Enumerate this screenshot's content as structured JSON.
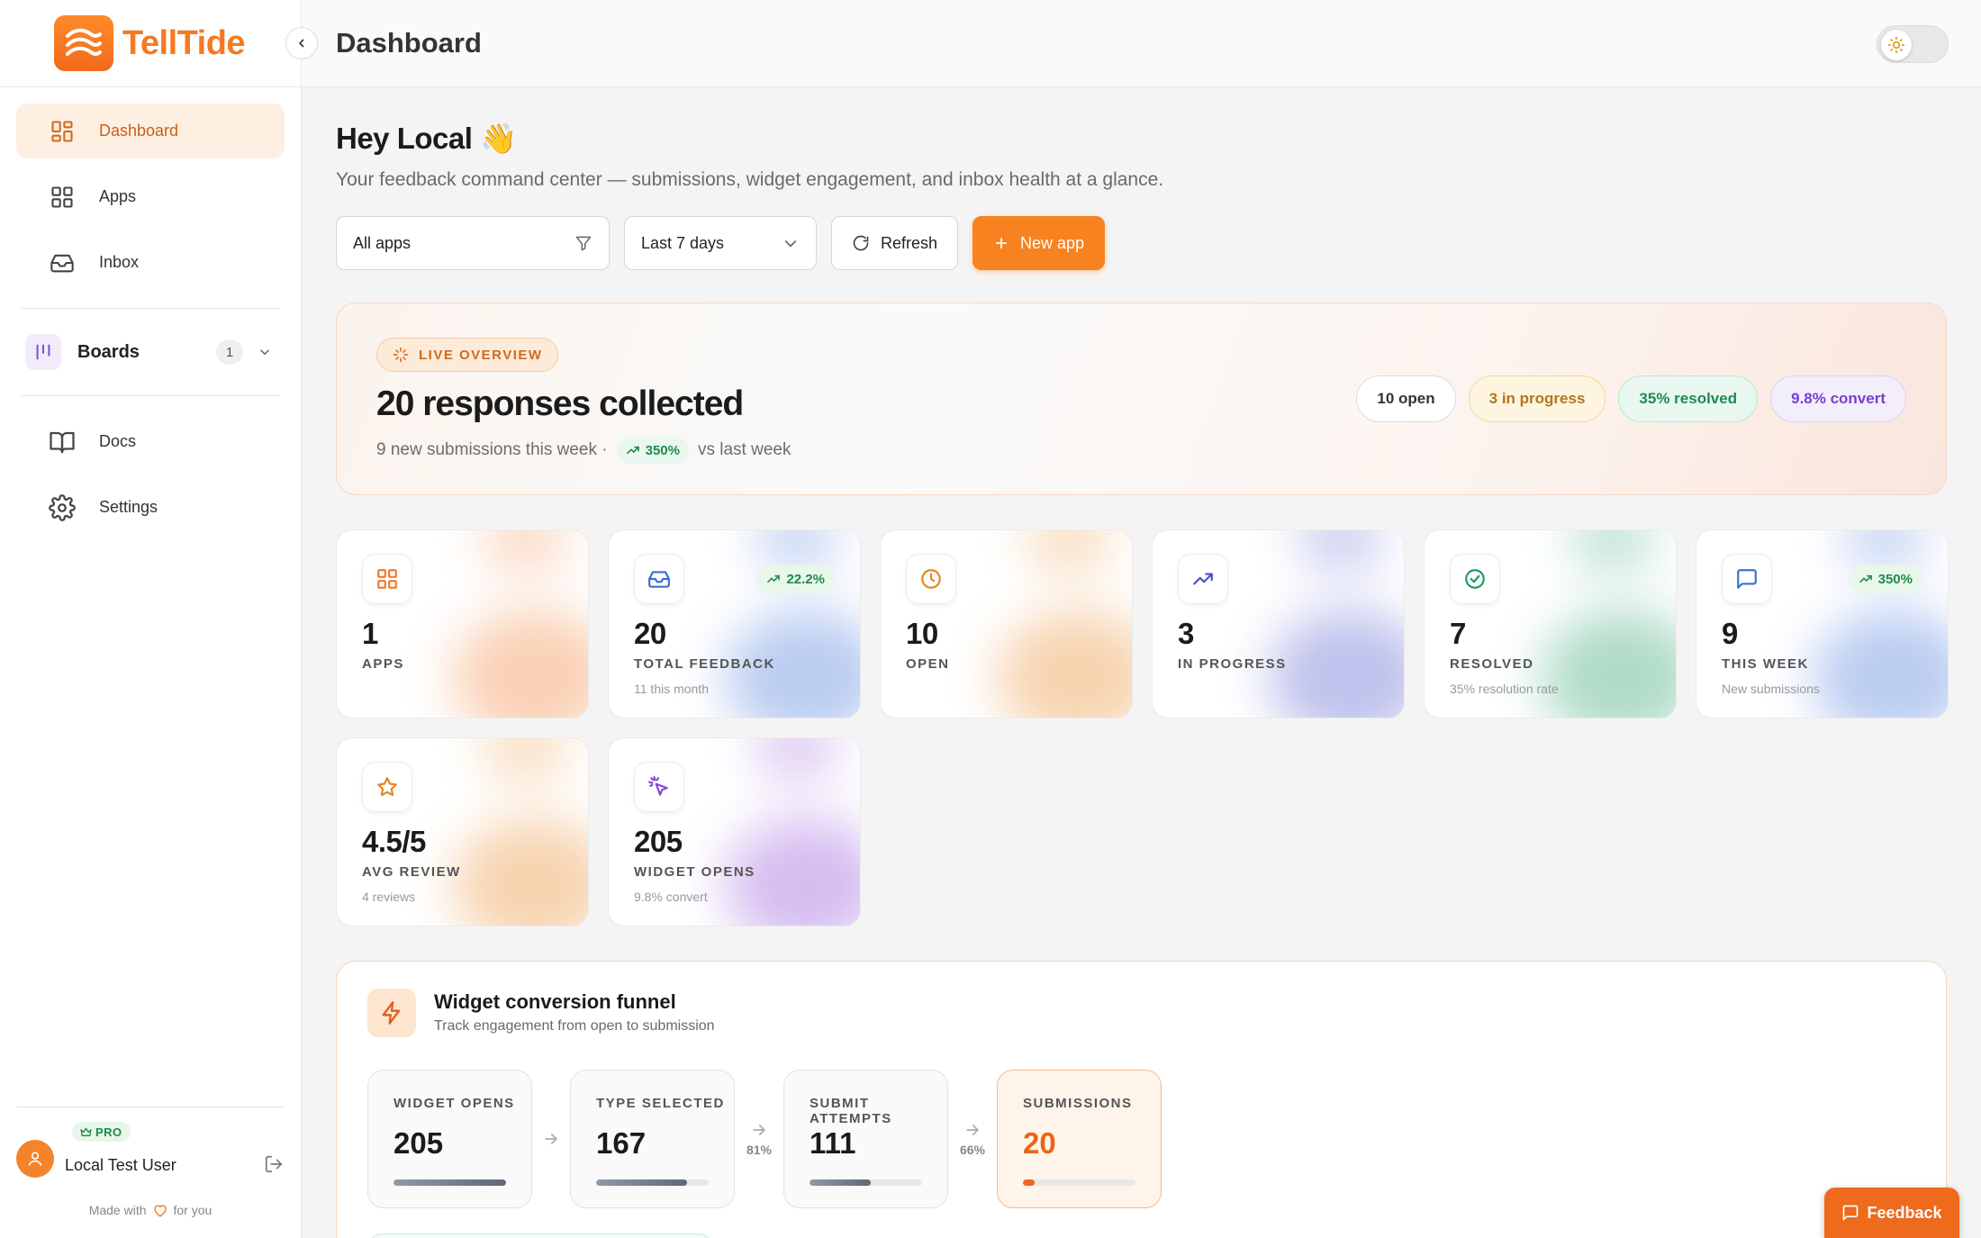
{
  "brand": {
    "name": "TellTide"
  },
  "sidebar": {
    "items": [
      {
        "label": "Dashboard",
        "icon": "grid-icon",
        "active": true
      },
      {
        "label": "Apps",
        "icon": "grid-icon"
      },
      {
        "label": "Inbox",
        "icon": "inbox-icon"
      }
    ],
    "boards": {
      "label": "Boards",
      "count": "1"
    },
    "secondary": [
      {
        "label": "Docs",
        "icon": "book-icon"
      },
      {
        "label": "Settings",
        "icon": "gear-icon"
      }
    ],
    "user": {
      "plan": "PRO",
      "name": "Local Test User"
    },
    "made_with": {
      "prefix": "Made with",
      "suffix": "for you"
    }
  },
  "header": {
    "title": "Dashboard"
  },
  "main": {
    "greeting": "Hey Local 👋",
    "subtitle": "Your feedback command center — submissions, widget engagement, and inbox health at a glance.",
    "filters": {
      "app_select": "All apps",
      "range_select": "Last 7 days"
    },
    "buttons": {
      "refresh": "Refresh",
      "new_app": "New app"
    }
  },
  "overview": {
    "pill": "LIVE OVERVIEW",
    "title": "20 responses collected",
    "sub_prefix": "9 new submissions this week ·",
    "trend": "350%",
    "sub_suffix": "vs last week",
    "pills": {
      "open": "10 open",
      "progress": "3 in progress",
      "resolved": "35% resolved",
      "convert": "9.8% convert"
    }
  },
  "stats": [
    {
      "value": "1",
      "label": "APPS",
      "note": "",
      "trend": "",
      "icon": "grid-icon",
      "color": "#f07a2a"
    },
    {
      "value": "20",
      "label": "TOTAL FEEDBACK",
      "note": "11 this month",
      "trend": "22.2%",
      "icon": "inbox-icon",
      "color": "#3b6fd8"
    },
    {
      "value": "10",
      "label": "OPEN",
      "note": "",
      "trend": "",
      "icon": "clock-icon",
      "color": "#e8841c"
    },
    {
      "value": "3",
      "label": "IN PROGRESS",
      "note": "",
      "trend": "",
      "icon": "trending-up-icon",
      "color": "#4750c9"
    },
    {
      "value": "7",
      "label": "RESOLVED",
      "note": "35% resolution rate",
      "trend": "",
      "icon": "check-circle-icon",
      "color": "#1e9a63"
    },
    {
      "value": "9",
      "label": "THIS WEEK",
      "note": "New submissions",
      "trend": "350%",
      "icon": "message-icon",
      "color": "#3b6fd8"
    },
    {
      "value": "4.5/5",
      "label": "AVG REVIEW",
      "note": "4 reviews",
      "trend": "",
      "icon": "star-icon",
      "color": "#e8841c"
    },
    {
      "value": "205",
      "label": "WIDGET OPENS",
      "note": "9.8% convert",
      "trend": "",
      "icon": "pointer-click-icon",
      "color": "#8a44d6"
    }
  ],
  "funnel": {
    "title": "Widget conversion funnel",
    "subtitle": "Track engagement from open to submission",
    "stages": [
      {
        "label": "WIDGET OPENS",
        "value": "205",
        "fill": 1.0
      },
      {
        "label": "TYPE SELECTED",
        "value": "167",
        "fill": 0.81
      },
      {
        "label": "SUBMIT ATTEMPTS",
        "value": "111",
        "fill": 0.54
      },
      {
        "label": "SUBMISSIONS",
        "value": "20",
        "fill": 0.1
      }
    ],
    "conversions": [
      "",
      "81%",
      "66%"
    ]
  },
  "feedback_button": "Feedback"
}
